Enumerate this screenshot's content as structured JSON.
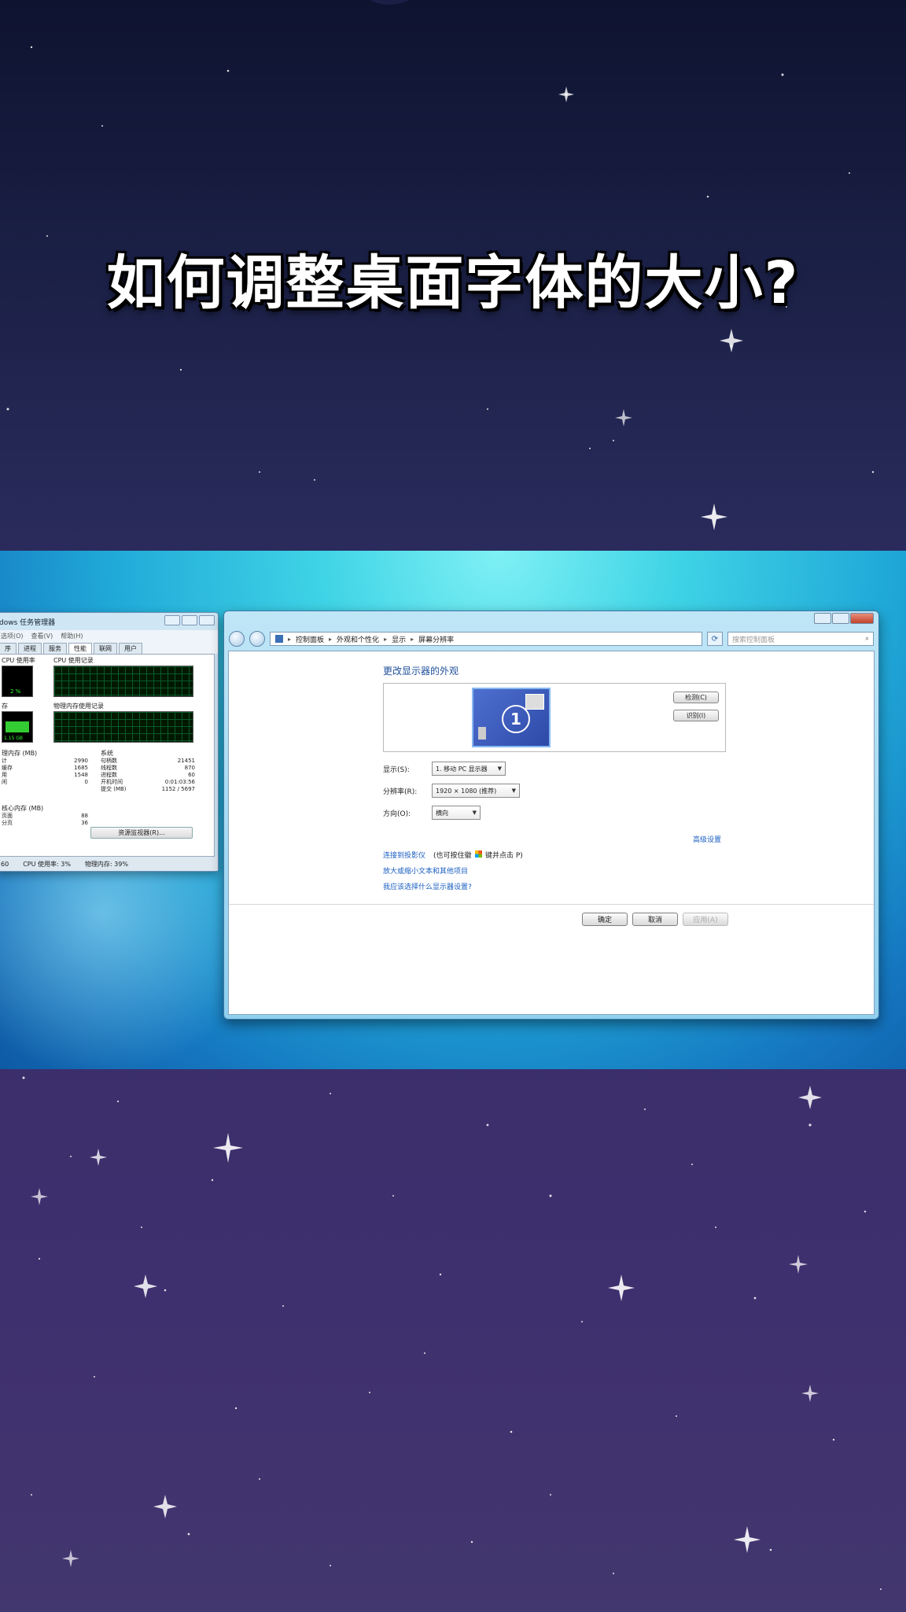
{
  "page": {
    "title": "如何调整桌面字体的大小?"
  },
  "task_manager": {
    "title": "dows 任务管理器",
    "menu": [
      "选项(O)",
      "查看(V)",
      "帮助(H)"
    ],
    "tabs": [
      "序",
      "进程",
      "服务",
      "性能",
      "联网",
      "用户"
    ],
    "active_tab": "性能",
    "cpu_usage_label": "CPU 使用率",
    "cpu_history_label": "CPU 使用记录",
    "cpu_value": "2 %",
    "mem_label": "存",
    "mem_history_label": "物理内存使用记录",
    "mem_value": "1.15 GB",
    "physical_mem_label": "理内存 (MB)",
    "physical_rows": [
      {
        "k": "计",
        "v": "2990"
      },
      {
        "k": "缓存",
        "v": "1685"
      },
      {
        "k": "用",
        "v": "1548"
      },
      {
        "k": "闲",
        "v": "0"
      }
    ],
    "system_label": "系统",
    "system_rows": [
      {
        "k": "句柄数",
        "v": "21451"
      },
      {
        "k": "线程数",
        "v": "870"
      },
      {
        "k": "进程数",
        "v": "60"
      },
      {
        "k": "开机时间",
        "v": "0:01:03:56"
      },
      {
        "k": "提交 (MB)",
        "v": "1152 / 5697"
      }
    ],
    "kernel_label": "核心内存 (MB)",
    "kernel_rows": [
      {
        "k": "页面",
        "v": "88"
      },
      {
        "k": "分页",
        "v": "36"
      }
    ],
    "resource_button": "资源监视器(R)...",
    "status": [
      "60",
      "CPU 使用率: 3%",
      "物理内存: 39%"
    ]
  },
  "control_panel": {
    "breadcrumb": [
      "控制面板",
      "外观和个性化",
      "显示",
      "屏幕分辨率"
    ],
    "search_placeholder": "搜索控制面板",
    "heading": "更改显示器的外观",
    "monitor_number": "1",
    "detect_button": "检测(C)",
    "identify_button": "识别(I)",
    "display_label": "显示(S):",
    "display_value": "1. 移动 PC 显示器",
    "resolution_label": "分辨率(R):",
    "resolution_value": "1920 × 1080 (推荐)",
    "orientation_label": "方向(O):",
    "orientation_value": "横向",
    "advanced_link": "高级设置",
    "projector_link": "连接到投影仪",
    "projector_hint": "(也可按住徽",
    "projector_hint2": "键并点击 P)",
    "text_size_link": "放大或缩小文本和其他项目",
    "which_settings_link": "我应该选择什么显示器设置?",
    "ok_button": "确定",
    "cancel_button": "取消",
    "apply_button": "应用(A)"
  }
}
